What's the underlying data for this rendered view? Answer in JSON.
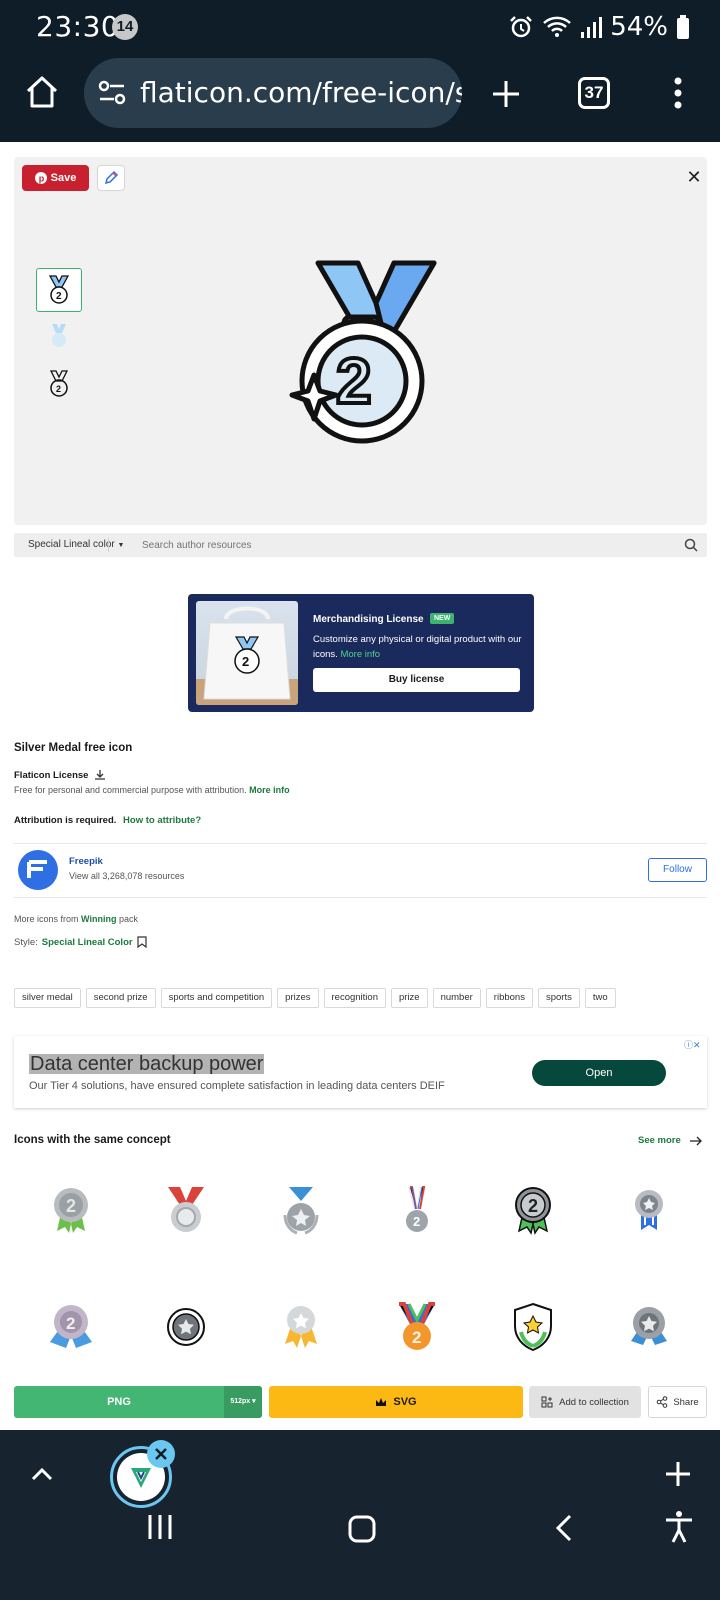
{
  "status_bar": {
    "time": "23:30",
    "notification_count": "14",
    "battery": "54%"
  },
  "browser": {
    "url": "flaticon.com/free-icon/si",
    "tab_count": "37"
  },
  "preview": {
    "save_label": "Save"
  },
  "style_bar": {
    "selected_style": "Special Lineal color",
    "search_placeholder": "Search author resources"
  },
  "merch": {
    "title": "Merchandising License",
    "badge": "NEW",
    "desc": "Customize any physical or digital product with our icons.",
    "more": "More info",
    "buy": "Buy license"
  },
  "icon_info": {
    "title": "Silver Medal free icon",
    "license_title": "Flaticon License",
    "license_desc": "Free for personal and commercial purpose with attribution.",
    "license_more": "More info",
    "attribution": "Attribution is required.",
    "how_to": "How to attribute?"
  },
  "author": {
    "name": "Freepik",
    "resources": "View all 3,268,078 resources",
    "follow": "Follow"
  },
  "pack": {
    "prefix": "More icons from",
    "name": "Winning",
    "suffix": "pack"
  },
  "style": {
    "prefix": "Style:",
    "name": "Special Lineal Color"
  },
  "tags": [
    "silver medal",
    "second prize",
    "sports and competition",
    "prizes",
    "recognition",
    "prize",
    "number",
    "ribbons",
    "sports",
    "two"
  ],
  "ad": {
    "title": "Data center backup power",
    "desc": "Our Tier 4 solutions, have ensured complete satisfaction in leading data centers DEIF",
    "cta": "Open"
  },
  "related": {
    "title": "Icons with the same concept",
    "see_more": "See more"
  },
  "actions": {
    "png": "PNG",
    "png_size": "512px",
    "svg": "SVG",
    "collection": "Add to collection",
    "share": "Share"
  },
  "colors": {
    "green": "#44b674",
    "yellow": "#fdb913",
    "navy": "#1b2a5c",
    "pinterest_red": "#c8202f",
    "freepik_blue": "#2f6fe4"
  }
}
